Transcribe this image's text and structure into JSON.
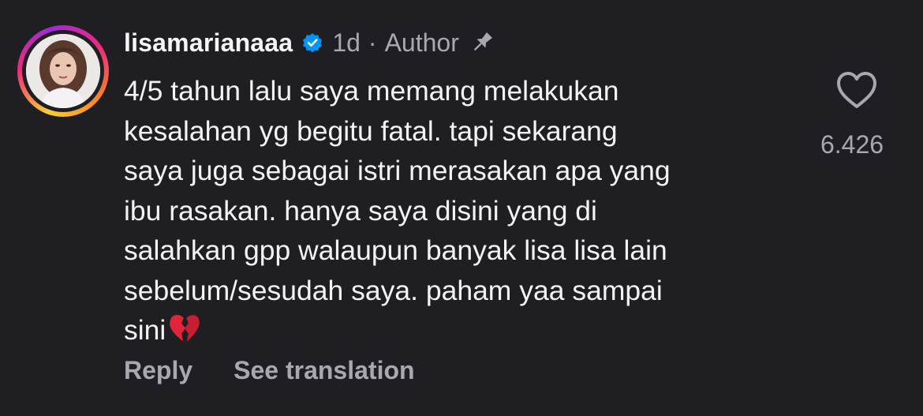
{
  "comment": {
    "username": "lisamarianaaa",
    "verified_icon": "verified-badge-icon",
    "time": "1d",
    "separator": "·",
    "author_label": "Author",
    "pinned_icon": "pin-icon",
    "text_lines": [
      "4/5 tahun lalu saya memang melakukan",
      "kesalahan yg begitu fatal. tapi sekarang",
      "saya juga sebagai istri merasakan apa yang",
      "ibu rasakan. hanya saya disini yang di",
      "salahkan gpp walaupun banyak lisa lisa lain",
      "sebelum/sesudah saya. paham yaa sampai",
      "sini"
    ],
    "trailing_emoji": "broken-heart-emoji",
    "like_icon": "heart-outline-icon",
    "like_count": "6.426",
    "reply_label": "Reply",
    "translate_label": "See translation"
  },
  "colors": {
    "background": "#1f1f23",
    "primary_text": "#f3f3f5",
    "secondary_text": "#a8a8b0",
    "verified_blue": "#0095f6",
    "broken_heart_red": "#e0243a"
  }
}
